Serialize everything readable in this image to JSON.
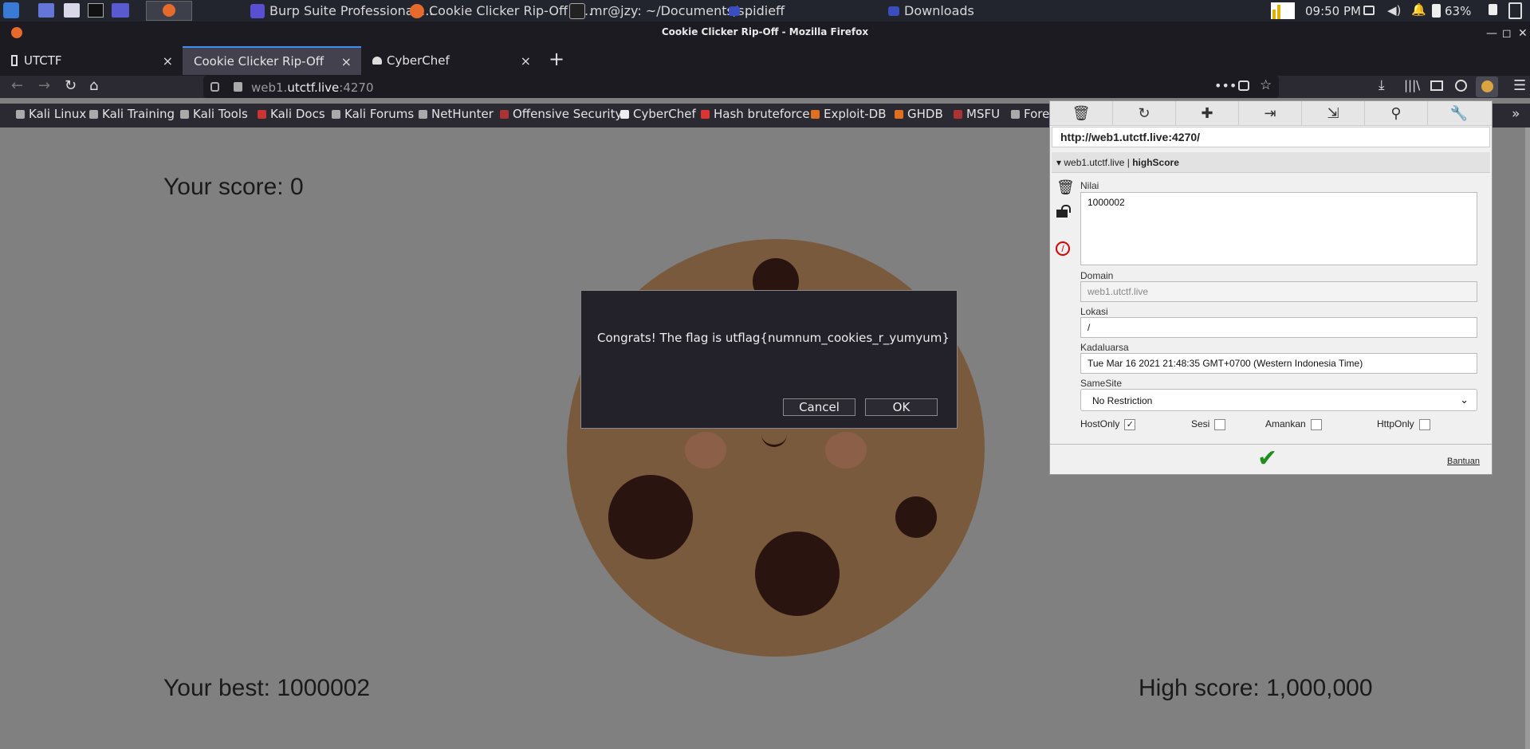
{
  "taskbar": {
    "apps": [
      {
        "label": "Burp Suite Professional ..."
      },
      {
        "label": "Cookie Clicker Rip-Off - ..."
      },
      {
        "label": "mr@jzy: ~/Documents/s..."
      },
      {
        "label": "pidieff"
      },
      {
        "label": "Downloads"
      }
    ],
    "clock": "09:50 PM",
    "battery": "63%"
  },
  "window": {
    "title": "Cookie Clicker Rip-Off - Mozilla Firefox"
  },
  "tabs": [
    {
      "label": "UTCTF",
      "close": "×"
    },
    {
      "label": "Cookie Clicker Rip-Off",
      "close": "×"
    },
    {
      "label": "CyberChef",
      "close": "×"
    }
  ],
  "new_tab": "+",
  "address": {
    "prefix": "web1.",
    "domain": "utctf.live",
    "port": ":4270"
  },
  "bookmarks": [
    "Kali Linux",
    "Kali Training",
    "Kali Tools",
    "Kali Docs",
    "Kali Forums",
    "NetHunter",
    "Offensive Security",
    "CyberChef",
    "Hash bruteforce",
    "Exploit-DB",
    "GHDB",
    "MSFU",
    "Fore"
  ],
  "page": {
    "your_score": "Your score: 0",
    "your_best": "Your best: 1000002",
    "high_score": "High score: 1,000,000"
  },
  "dialog": {
    "message": "Congrats! The flag is utflag{numnum_cookies_r_yumyum}",
    "cancel": "Cancel",
    "ok": "OK"
  },
  "cookie_editor": {
    "url": "http://web1.utctf.live:4270/",
    "cookie_host": "web1.utctf.live",
    "separator": " | ",
    "cookie_name": "highScore",
    "value_label": "Nilai",
    "value": "1000002",
    "domain_label": "Domain",
    "domain_value": "web1.utctf.live",
    "path_label": "Lokasi",
    "path_value": "/",
    "expires_label": "Kadaluarsa",
    "expires_value": "Tue Mar 16 2021 21:48:35 GMT+0700 (Western Indonesia Time)",
    "samesite_label": "SameSite",
    "samesite_value": "No Restriction",
    "hostonly_label": "HostOnly",
    "session_label": "Sesi",
    "secure_label": "Amankan",
    "httponly_label": "HttpOnly",
    "help": "Bantuan"
  },
  "colors": {
    "accent": "#3e8ff2",
    "cookie": "#7a5a3c",
    "chip": "#2a1410",
    "save": "#1f8f1f"
  }
}
